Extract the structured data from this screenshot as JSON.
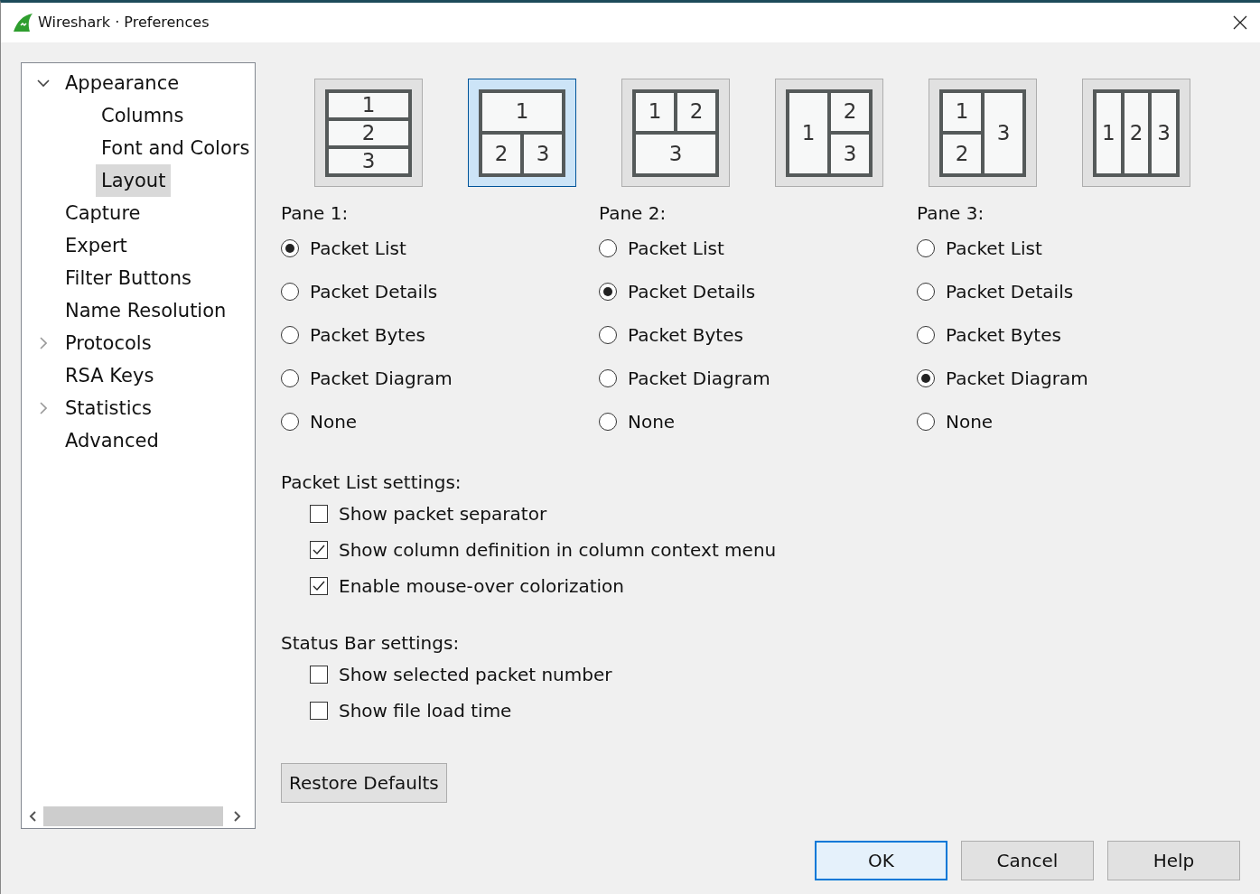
{
  "window": {
    "title": "Wireshark · Preferences"
  },
  "tree": [
    {
      "label": "Appearance",
      "selected": false,
      "expanded": true,
      "children": [
        {
          "label": "Columns",
          "selected": false
        },
        {
          "label": "Font and Colors",
          "selected": false
        },
        {
          "label": "Layout",
          "selected": true
        }
      ]
    },
    {
      "label": "Capture",
      "selected": false
    },
    {
      "label": "Expert",
      "selected": false
    },
    {
      "label": "Filter Buttons",
      "selected": false
    },
    {
      "label": "Name Resolution",
      "selected": false
    },
    {
      "label": "Protocols",
      "selected": false,
      "expanded": false
    },
    {
      "label": "RSA Keys",
      "selected": false
    },
    {
      "label": "Statistics",
      "selected": false,
      "expanded": false
    },
    {
      "label": "Advanced",
      "selected": false
    }
  ],
  "layouts": [
    {
      "kind": "rows",
      "selected": false,
      "panes": [
        "1",
        "2",
        "3"
      ]
    },
    {
      "kind": "top-over-split",
      "selected": true,
      "panes": [
        "1",
        "2",
        "3"
      ]
    },
    {
      "kind": "split-over-bottom",
      "selected": false,
      "panes": [
        "1",
        "2",
        "3"
      ]
    },
    {
      "kind": "left-beside-split",
      "selected": false,
      "panes": [
        "1",
        "2",
        "3"
      ]
    },
    {
      "kind": "split-beside-right",
      "selected": false,
      "panes": [
        "1",
        "2",
        "3"
      ]
    },
    {
      "kind": "columns",
      "selected": false,
      "panes": [
        "1",
        "2",
        "3"
      ]
    }
  ],
  "panes": [
    {
      "label": "Pane 1:",
      "options": [
        {
          "label": "Packet List",
          "selected": true
        },
        {
          "label": "Packet Details",
          "selected": false
        },
        {
          "label": "Packet Bytes",
          "selected": false
        },
        {
          "label": "Packet Diagram",
          "selected": false
        },
        {
          "label": "None",
          "selected": false
        }
      ]
    },
    {
      "label": "Pane 2:",
      "options": [
        {
          "label": "Packet List",
          "selected": false
        },
        {
          "label": "Packet Details",
          "selected": true
        },
        {
          "label": "Packet Bytes",
          "selected": false
        },
        {
          "label": "Packet Diagram",
          "selected": false
        },
        {
          "label": "None",
          "selected": false
        }
      ]
    },
    {
      "label": "Pane 3:",
      "options": [
        {
          "label": "Packet List",
          "selected": false
        },
        {
          "label": "Packet Details",
          "selected": false
        },
        {
          "label": "Packet Bytes",
          "selected": false
        },
        {
          "label": "Packet Diagram",
          "selected": true
        },
        {
          "label": "None",
          "selected": false
        }
      ]
    }
  ],
  "settings_groups": [
    {
      "label": "Packet List settings:",
      "items": [
        {
          "label": "Show packet separator",
          "checked": false
        },
        {
          "label": "Show column definition in column context menu",
          "checked": true
        },
        {
          "label": "Enable mouse-over colorization",
          "checked": true
        }
      ]
    },
    {
      "label": "Status Bar settings:",
      "items": [
        {
          "label": "Show selected packet number",
          "checked": false
        },
        {
          "label": "Show file load time",
          "checked": false
        }
      ]
    }
  ],
  "restore_button": "Restore Defaults",
  "buttons": [
    {
      "label": "OK",
      "selected": true
    },
    {
      "label": "Cancel",
      "selected": false
    },
    {
      "label": "Help",
      "selected": false
    }
  ]
}
